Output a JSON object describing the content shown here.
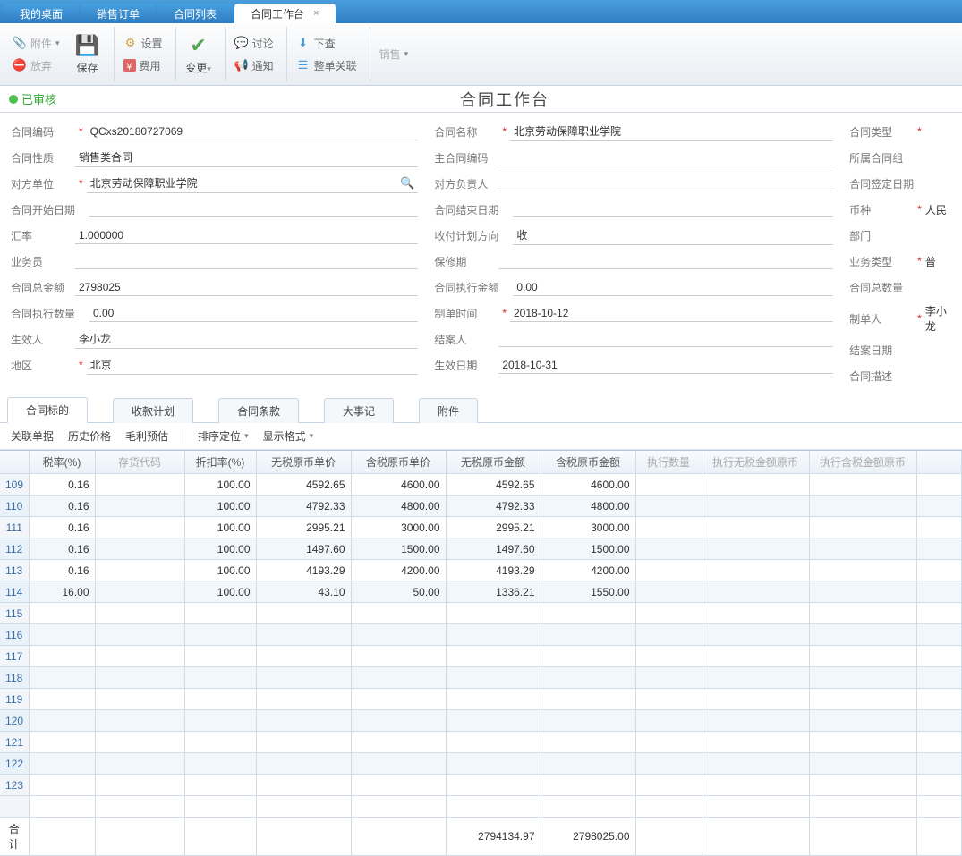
{
  "tabs": {
    "items": [
      {
        "label": "我的桌面"
      },
      {
        "label": "销售订单"
      },
      {
        "label": "合同列表"
      },
      {
        "label": "合同工作台"
      }
    ]
  },
  "toolbar": {
    "attachment": "附件",
    "discard": "放弃",
    "save": "保存",
    "settings": "设置",
    "fee": "费用",
    "change": "变更",
    "discuss": "讨论",
    "notify": "通知",
    "issue": "下查",
    "relate": "整单关联",
    "sales": "销售"
  },
  "status": {
    "text": "已审核"
  },
  "pageTitle": "合同工作台",
  "form": {
    "colA": {
      "contractCodeLabel": "合同编码",
      "contractCode": "QCxs20180727069",
      "contractNatureLabel": "合同性质",
      "contractNature": "销售类合同",
      "counterpartyLabel": "对方单位",
      "counterparty": "北京劳动保障职业学院",
      "startDateLabel": "合同开始日期",
      "startDate": "",
      "rateLabel": "汇率",
      "rate": "1.000000",
      "salespersonLabel": "业务员",
      "salesperson": "",
      "totalAmountLabel": "合同总金额",
      "totalAmount": "2798025",
      "execQtyLabel": "合同执行数量",
      "execQty": "0.00",
      "effectorLabel": "生效人",
      "effector": "李小龙",
      "regionLabel": "地区",
      "region": "北京"
    },
    "colB": {
      "contractNameLabel": "合同名称",
      "contractName": "北京劳动保障职业学院",
      "mainCodeLabel": "主合同编码",
      "mainCode": "",
      "oppOwnerLabel": "对方负责人",
      "oppOwner": "",
      "endDateLabel": "合同结束日期",
      "endDate": "",
      "planDirLabel": "收付计划方向",
      "planDir": "收",
      "warrantyLabel": "保修期",
      "warranty": "",
      "execAmtLabel": "合同执行金额",
      "execAmt": "0.00",
      "makeTimeLabel": "制单时间",
      "makeTime": "2018-10-12",
      "closerLabel": "结案人",
      "closer": "",
      "effectDateLabel": "生效日期",
      "effectDate": "2018-10-31"
    },
    "colC": {
      "contractTypeLabel": "合同类型",
      "groupLabel": "所属合同组",
      "signDateLabel": "合同签定日期",
      "currencyLabel": "币种",
      "currency": "人民",
      "deptLabel": "部门",
      "bizTypeLabel": "业务类型",
      "bizType": "普",
      "totalQtyLabel": "合同总数量",
      "makerLabel": "制单人",
      "maker": "李小龙",
      "closeDateLabel": "结案日期",
      "descLabel": "合同描述"
    }
  },
  "subtabs": [
    "合同标的",
    "收款计划",
    "合同条款",
    "大事记",
    "附件"
  ],
  "gridtools": {
    "relDoc": "关联单据",
    "histPrice": "历史价格",
    "grossEst": "毛利预估",
    "sortLoc": "排序定位",
    "dispFmt": "显示格式"
  },
  "grid": {
    "headers": [
      "税率(%)",
      "存货代码",
      "折扣率(%)",
      "无税原币单价",
      "含税原币单价",
      "无税原币金额",
      "含税原币金额",
      "执行数量",
      "执行无税金额原币",
      "执行含税金额原币"
    ],
    "rows": [
      {
        "n": "109",
        "c1": "0.16",
        "c3": "100.00",
        "c4": "4592.65",
        "c5": "4600.00",
        "c6": "4592.65",
        "c7": "4600.00"
      },
      {
        "n": "110",
        "c1": "0.16",
        "c3": "100.00",
        "c4": "4792.33",
        "c5": "4800.00",
        "c6": "4792.33",
        "c7": "4800.00"
      },
      {
        "n": "111",
        "c1": "0.16",
        "c3": "100.00",
        "c4": "2995.21",
        "c5": "3000.00",
        "c6": "2995.21",
        "c7": "3000.00"
      },
      {
        "n": "112",
        "c1": "0.16",
        "c3": "100.00",
        "c4": "1497.60",
        "c5": "1500.00",
        "c6": "1497.60",
        "c7": "1500.00"
      },
      {
        "n": "113",
        "c1": "0.16",
        "c3": "100.00",
        "c4": "4193.29",
        "c5": "4200.00",
        "c6": "4193.29",
        "c7": "4200.00"
      },
      {
        "n": "114",
        "c1": "16.00",
        "c3": "100.00",
        "c4": "43.10",
        "c5": "50.00",
        "c6": "1336.21",
        "c7": "1550.00"
      },
      {
        "n": "115"
      },
      {
        "n": "116"
      },
      {
        "n": "117"
      },
      {
        "n": "118"
      },
      {
        "n": "119"
      },
      {
        "n": "120"
      },
      {
        "n": "121"
      },
      {
        "n": "122"
      },
      {
        "n": "123"
      }
    ],
    "totalLabel": "合计",
    "total": {
      "c6": "2794134.97",
      "c7": "2798025.00"
    }
  }
}
